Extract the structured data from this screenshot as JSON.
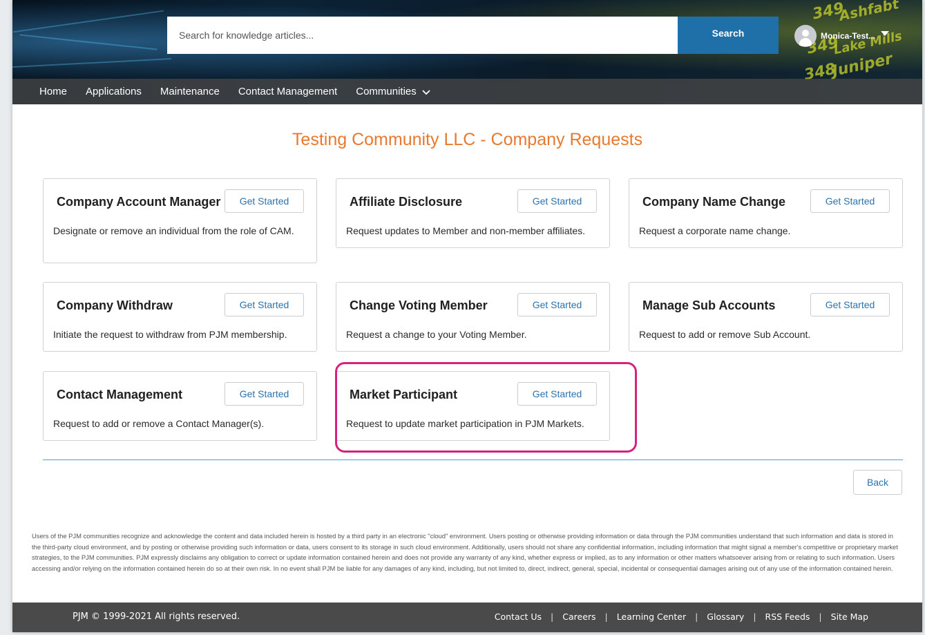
{
  "header": {
    "search_placeholder": "Search for knowledge articles...",
    "search_button": "Search",
    "user_name": "Monica-Test..."
  },
  "nav": {
    "items": [
      {
        "label": "Home"
      },
      {
        "label": "Applications"
      },
      {
        "label": "Maintenance"
      },
      {
        "label": "Contact Management"
      },
      {
        "label": "Communities"
      }
    ]
  },
  "page_title": "Testing Community LLC - Company Requests",
  "cards": [
    {
      "title": "Company Account Manager",
      "button": "Get Started",
      "description": "Designate or remove an individual from the role of CAM."
    },
    {
      "title": "Affiliate Disclosure",
      "button": "Get Started",
      "description": "Request updates to Member and non-member affiliates."
    },
    {
      "title": "Company Name Change",
      "button": "Get Started",
      "description": "Request a corporate name change."
    },
    {
      "title": "Company Withdraw",
      "button": "Get Started",
      "description": "Initiate the request to withdraw from PJM membership."
    },
    {
      "title": "Change Voting Member",
      "button": "Get Started",
      "description": "Request a change to your Voting Member."
    },
    {
      "title": "Manage Sub Accounts",
      "button": "Get Started",
      "description": "Request to add or remove Sub Account."
    },
    {
      "title": "Contact Management",
      "button": "Get Started",
      "description": "Request to add or remove a Contact Manager(s)."
    },
    {
      "title": "Market Participant",
      "button": "Get Started",
      "description": "Request to update market participation in PJM Markets."
    }
  ],
  "back_button": "Back",
  "disclaimer": "Users of the PJM communities recognize and acknowledge the content and data included herein is hosted by a third party in an electronic \"cloud\" environment. Users posting or otherwise providing information or data through the PJM communities understand that such information and data is stored in the third-party cloud environment, and by posting or otherwise providing such information or data, users consent to its storage in such cloud environment. Additionally, users should not share any confidential information, including information that might signal a member's competitive or proprietary market strategies, to the PJM communities. PJM expressly disclaims any obligation to correct or update information contained herein and does not provide any warranty of any kind, whether express or implied, as to any information or other matters whatsoever arising from or relating to such information. Users accessing and/or relying on the information contained herein do so at their own risk. In no event shall PJM be liable for any damages of any kind, including, but not limited to, direct, indirect, general, special, incidental or consequential damages arising out of any use of the information contained herein.",
  "footer": {
    "copyright": "PJM © 1999-2021 All rights reserved.",
    "links": [
      "Contact Us",
      "Careers",
      "Learning Center",
      "Glossary",
      "RSS Feeds",
      "Site Map"
    ],
    "separator": "|"
  },
  "colors": {
    "title_orange": "#e8792e",
    "link_blue": "#2a73b0",
    "search_button_blue": "#1f6fa8",
    "highlight_magenta": "#d6227d",
    "footer_gray": "#4a4a4a"
  },
  "ticker_text": [
    "349",
    "Ashfabt",
    "349",
    "Lake Mills",
    "348",
    "Juniper"
  ]
}
